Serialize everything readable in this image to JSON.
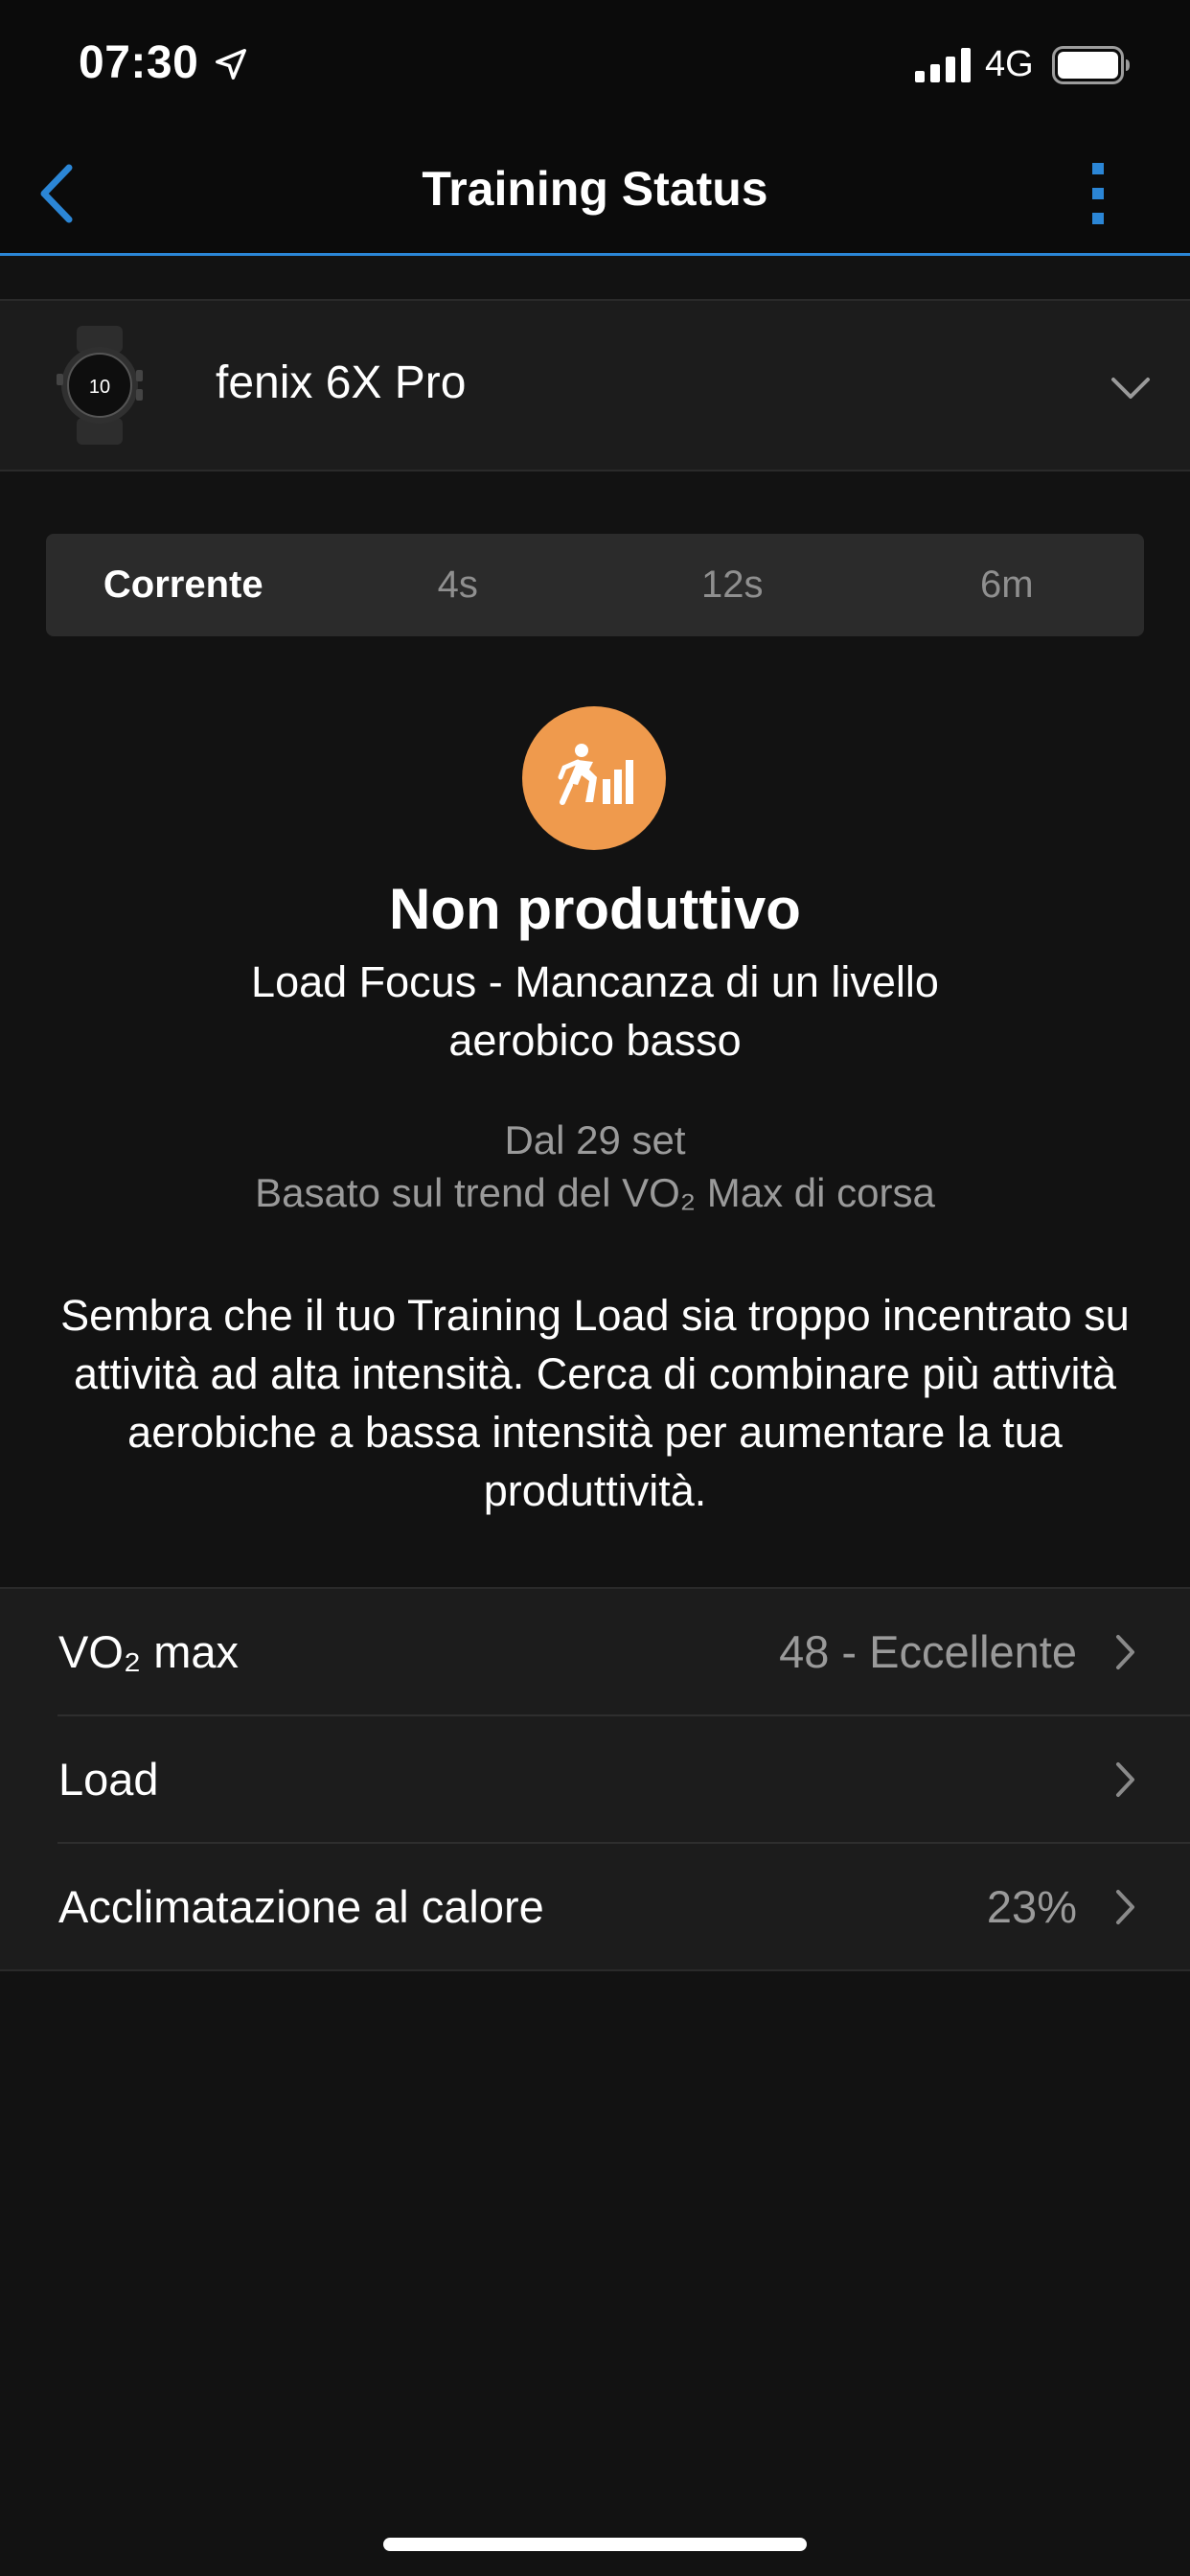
{
  "status_bar": {
    "time": "07:30",
    "network": "4G"
  },
  "header": {
    "title": "Training Status"
  },
  "device": {
    "name": "fenix 6X Pro",
    "watch_face_text": "10"
  },
  "tabs": [
    {
      "label": "Corrente",
      "active": true
    },
    {
      "label": "4s",
      "active": false
    },
    {
      "label": "12s",
      "active": false
    },
    {
      "label": "6m",
      "active": false
    }
  ],
  "status": {
    "title": "Non produttivo",
    "subtitle": "Load Focus - Mancanza di un livello aerobico basso",
    "since": "Dal 29 set",
    "basis": "Basato sul trend del VO₂ Max di corsa",
    "description": "Sembra che il tuo Training Load sia troppo incentrato su attività ad alta intensità. Cerca di combinare più attività aerobiche a bassa intensità per aumentare la tua produttività.",
    "icon": "runner-bars-icon",
    "color": "#ef9a4d"
  },
  "metrics": [
    {
      "label": "VO₂ max",
      "value": "48 - Eccellente"
    },
    {
      "label": "Load",
      "value": ""
    },
    {
      "label": "Acclimatazione al calore",
      "value": "23%"
    }
  ],
  "colors": {
    "accent": "#2b86d6",
    "background": "#121212",
    "status_orange": "#ef9a4d"
  }
}
